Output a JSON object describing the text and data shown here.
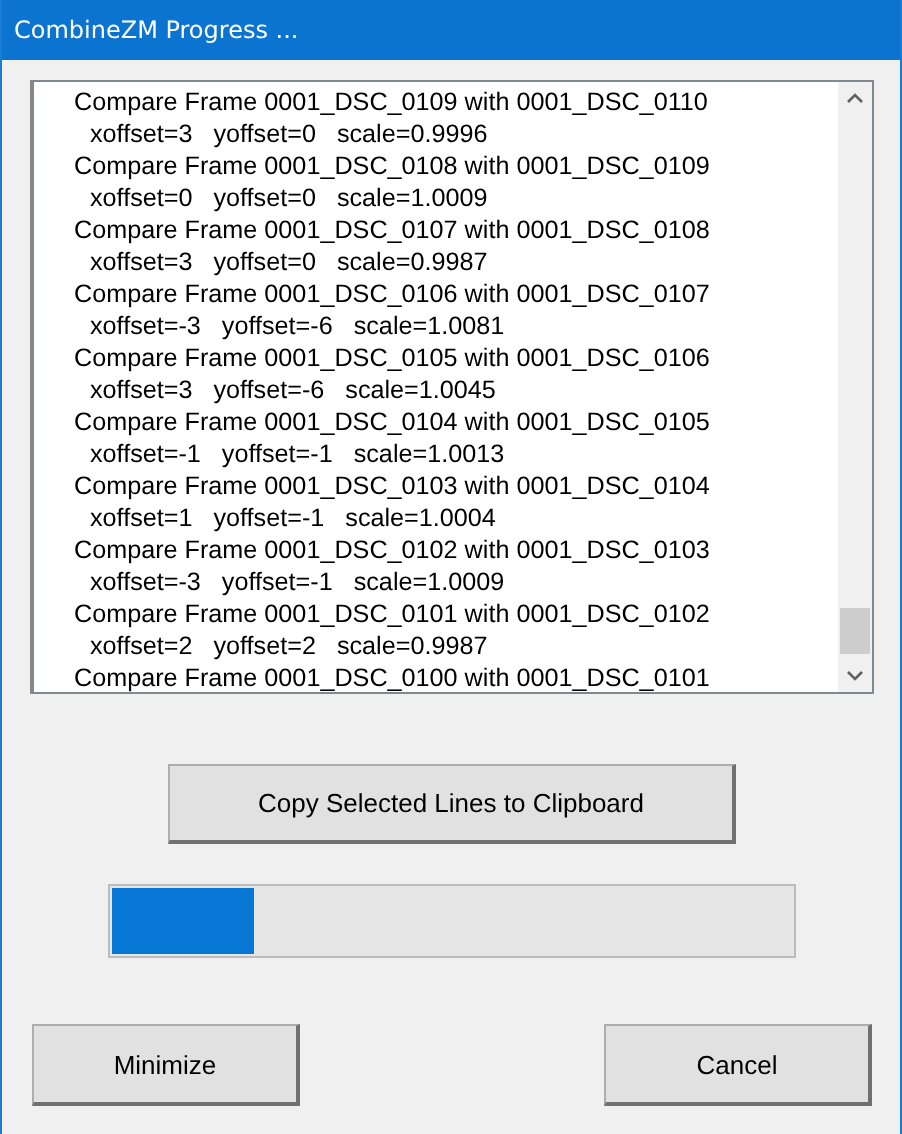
{
  "window": {
    "title": "CombineZM Progress ..."
  },
  "log_lines": [
    {
      "kind": "compare",
      "text": "Compare Frame 0001_DSC_0109 with 0001_DSC_0110"
    },
    {
      "kind": "offset",
      "text": "xoffset=3   yoffset=0   scale=0.9996"
    },
    {
      "kind": "compare",
      "text": "Compare Frame 0001_DSC_0108 with 0001_DSC_0109"
    },
    {
      "kind": "offset",
      "text": "xoffset=0   yoffset=0   scale=1.0009"
    },
    {
      "kind": "compare",
      "text": "Compare Frame 0001_DSC_0107 with 0001_DSC_0108"
    },
    {
      "kind": "offset",
      "text": "xoffset=3   yoffset=0   scale=0.9987"
    },
    {
      "kind": "compare",
      "text": "Compare Frame 0001_DSC_0106 with 0001_DSC_0107"
    },
    {
      "kind": "offset",
      "text": "xoffset=-3   yoffset=-6   scale=1.0081"
    },
    {
      "kind": "compare",
      "text": "Compare Frame 0001_DSC_0105 with 0001_DSC_0106"
    },
    {
      "kind": "offset",
      "text": "xoffset=3   yoffset=-6   scale=1.0045"
    },
    {
      "kind": "compare",
      "text": "Compare Frame 0001_DSC_0104 with 0001_DSC_0105"
    },
    {
      "kind": "offset",
      "text": "xoffset=-1   yoffset=-1   scale=1.0013"
    },
    {
      "kind": "compare",
      "text": "Compare Frame 0001_DSC_0103 with 0001_DSC_0104"
    },
    {
      "kind": "offset",
      "text": "xoffset=1   yoffset=-1   scale=1.0004"
    },
    {
      "kind": "compare",
      "text": "Compare Frame 0001_DSC_0102 with 0001_DSC_0103"
    },
    {
      "kind": "offset",
      "text": "xoffset=-3   yoffset=-1   scale=1.0009"
    },
    {
      "kind": "compare",
      "text": "Compare Frame 0001_DSC_0101 with 0001_DSC_0102"
    },
    {
      "kind": "offset",
      "text": "xoffset=2   yoffset=2   scale=0.9987"
    },
    {
      "kind": "compare",
      "text": "Compare Frame 0001_DSC_0100 with 0001_DSC_0101"
    }
  ],
  "copy_button": "Copy Selected Lines to Clipboard",
  "progress": {
    "level": 0.21
  },
  "buttons": [
    {
      "label": "Minimize"
    },
    {
      "label": "Cancel"
    }
  ]
}
